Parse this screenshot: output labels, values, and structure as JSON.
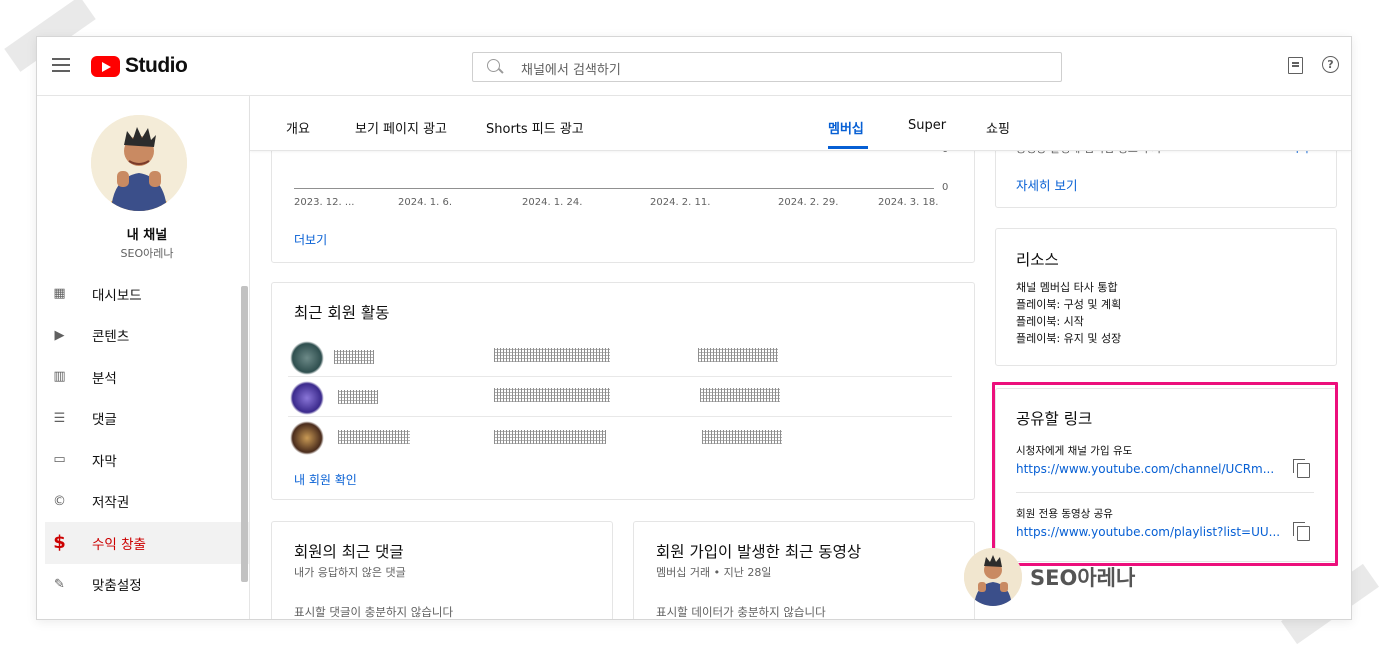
{
  "header": {
    "logo_text": "Studio",
    "search_placeholder": "채널에서 검색하기"
  },
  "sidebar": {
    "channel_title": "내 채널",
    "channel_name": "SEO아레나",
    "items": [
      {
        "label": "대시보드",
        "icon": "dashboard-icon"
      },
      {
        "label": "콘텐츠",
        "icon": "content-icon"
      },
      {
        "label": "분석",
        "icon": "analytics-icon"
      },
      {
        "label": "댓글",
        "icon": "comments-icon"
      },
      {
        "label": "자막",
        "icon": "subtitles-icon"
      },
      {
        "label": "저작권",
        "icon": "copyright-icon"
      },
      {
        "label": "수익 창출",
        "icon": "monetization-icon",
        "active": true
      },
      {
        "label": "맞춤설정",
        "icon": "customization-icon"
      }
    ]
  },
  "tabs": [
    {
      "label": "개요"
    },
    {
      "label": "보기 페이지 광고"
    },
    {
      "label": "Shorts 피드 광고"
    },
    {
      "label": "멤버십",
      "active": true
    },
    {
      "label": "Super"
    },
    {
      "label": "쇼핑"
    }
  ],
  "chart_card": {
    "x_ticks": [
      "2023. 12. ...",
      "2024. 1. 6.",
      "2024. 1. 24.",
      "2024. 2. 11.",
      "2024. 2. 29.",
      "2024. 3. 18."
    ],
    "y_zero": "0",
    "more_link": "더보기"
  },
  "activity_card": {
    "title": "최근 회원 활동",
    "view_link": "내 회원 확인"
  },
  "comments_card": {
    "title": "회원의 최근 댓글",
    "subtitle": "내가 응답하지 않은 댓글",
    "cut_text": "표시할 댓글이 충분하지 않습니다"
  },
  "videos_card": {
    "title": "회원 가입이 발생한 최근 동영상",
    "subtitle": "멤버십 거래 • 지난 28일",
    "cut_text": "표시할 데이터가 충분하지 않습니다"
  },
  "right_top_card": {
    "cut_text": "동영상 발생에 멤버십 링크 추가",
    "cut_action": "시작",
    "link": "자세히 보기"
  },
  "resources_card": {
    "title": "리소스",
    "items": [
      "채널 멤버십 타사 통합",
      "플레이북: 구성 및 계획",
      "플레이북: 시작",
      "플레이북: 유지 및 성장"
    ]
  },
  "share_card": {
    "title": "공유할 링크",
    "links": [
      {
        "label": "시청자에게 채널 가입 유도",
        "url": "https://www.youtube.com/channel/UCRm..."
      },
      {
        "label": "회원 전용 동영상 공유",
        "url": "https://www.youtube.com/playlist?list=UU..."
      }
    ]
  },
  "watermark": {
    "text": "SEO아레나"
  },
  "colors": {
    "brand_red": "#ff0000",
    "link_blue": "#065fd4",
    "active_red": "#cc0000",
    "highlight_pink": "#ec0f7c"
  }
}
